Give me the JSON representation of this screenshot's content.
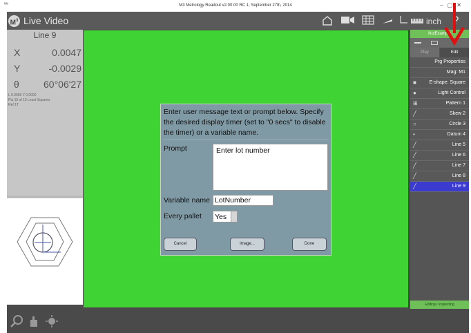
{
  "window": {
    "title": "M3 Metrology Readout  v2.00.00 RC 1, September 27th, 2014",
    "icon": "mm-icon"
  },
  "toolbar": {
    "logo_letter": "M",
    "logo_sup": "3",
    "title": "Live Video",
    "units": "inch",
    "help": "?"
  },
  "readout": {
    "feature": "Line 9",
    "rows": [
      {
        "label": "X",
        "value": "0.0047"
      },
      {
        "label": "Y",
        "value": "-0.0029"
      },
      {
        "label": "θ",
        "value": "60°06'27"
      }
    ],
    "info": [
      "L    0.0055     Y    0.0000",
      "Pts 15 of 15     Least Squares",
      "Ref 1T"
    ]
  },
  "program": {
    "name": "NutExample",
    "tabs": [
      "Play",
      "Edit"
    ],
    "active_tab": "Edit",
    "rows": [
      {
        "label": "Prg Properties",
        "icon": ""
      },
      {
        "label": "Mag: M1",
        "icon": ""
      },
      {
        "label": "E-shape: Square",
        "icon": "■"
      },
      {
        "label": "Light Control",
        "icon": "●"
      },
      {
        "label": "Pattern 1",
        "icon": "⊞"
      },
      {
        "label": "Skew 2",
        "icon": "╱"
      },
      {
        "label": "Circle 3",
        "icon": "○"
      },
      {
        "label": "Datum 4",
        "icon": "•"
      },
      {
        "label": "Line 5",
        "icon": "╱"
      },
      {
        "label": "Line 6",
        "icon": "╱"
      },
      {
        "label": "Line 7",
        "icon": "╱"
      },
      {
        "label": "Line 8",
        "icon": "╱"
      },
      {
        "label": "Line 9",
        "icon": "╱"
      }
    ],
    "selected": "Line 9",
    "footer": "Editing / Inspecting"
  },
  "dialog": {
    "message": "Enter user message text or prompt below. Specify the desired display timer (set to \"0 secs\" to disable the timer) or a variable name.",
    "prompt_label": "Prompt",
    "prompt_value": "Enter lot number",
    "variable_label": "Variable name",
    "variable_value": "LotNumber",
    "pallet_label": "Every pallet",
    "pallet_value": "Yes",
    "buttons": {
      "cancel": "Cancel",
      "image": "Image...",
      "done": "Done"
    }
  },
  "colors": {
    "video": "#3fd434",
    "selected_row": "#3b3bcf",
    "annotation_arrow": "#e01010"
  }
}
